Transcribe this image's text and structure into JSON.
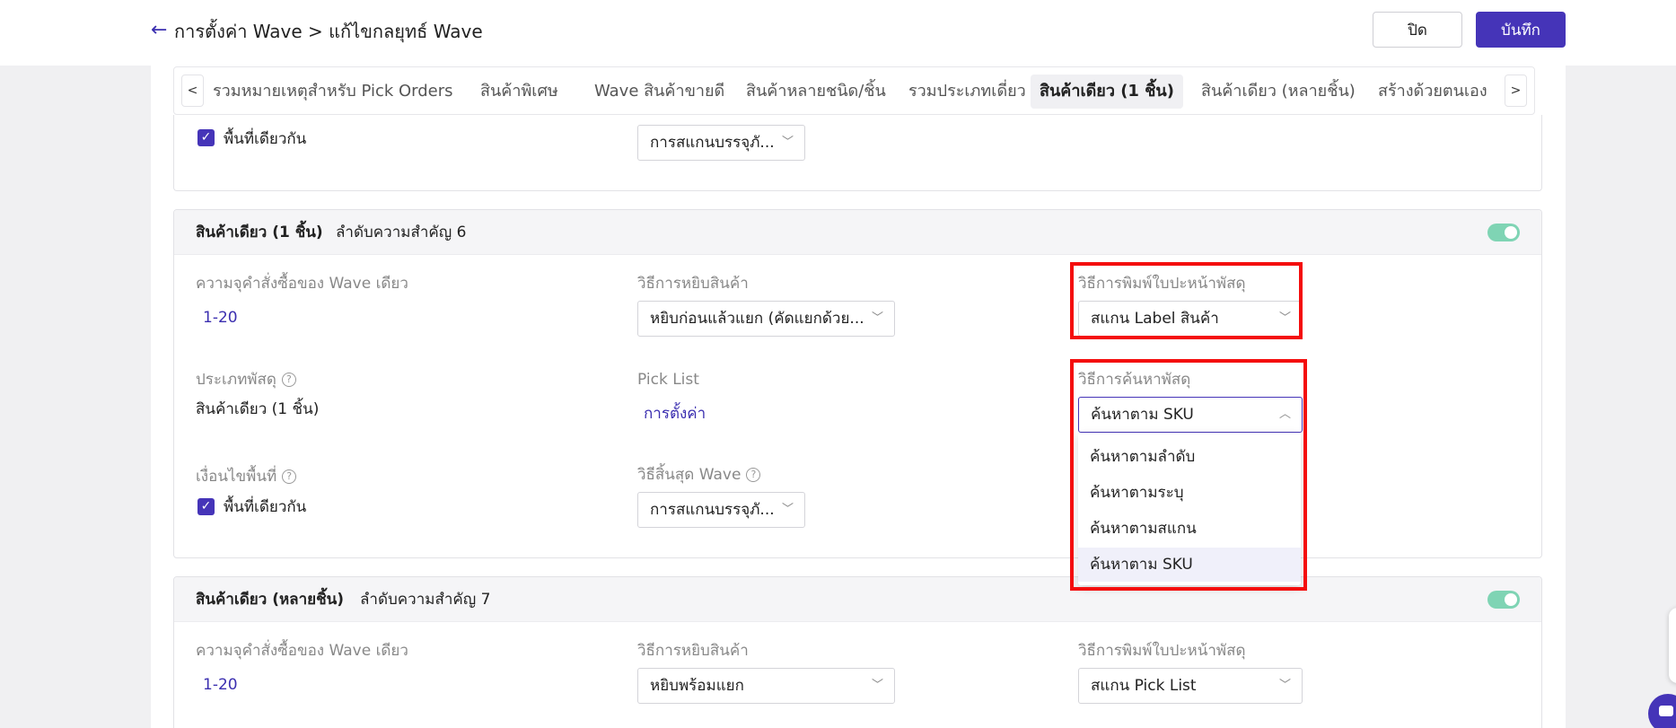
{
  "header": {
    "breadcrumb": "การตั้งค่า Wave > แก้ไขกลยุทธ์ Wave",
    "close_label": "ปิด",
    "save_label": "บันทึก"
  },
  "tabs": [
    "รวมหมายเหตุสำหรับ Pick Orders",
    "สินค้าพิเศษ",
    "Wave สินค้าขายดี",
    "สินค้าหลายชนิด/ชิ้น",
    "รวมประเภทเดี่ยว",
    "สินค้าเดียว (1 ชิ้น)",
    "สินค้าเดียว (หลายชิ้น)",
    "สร้างด้วยตนเอง"
  ],
  "active_tab_index": 5,
  "top_card": {
    "checkbox_label": "พื้นที่เดียวกัน",
    "end_select": "การสแกนบรรจุภั..."
  },
  "card_single": {
    "title": "สินค้าเดียว (1 ชิ้น)",
    "priority": "ลำดับความสำคัญ 6",
    "enabled": true,
    "capacity_label": "ความจุคำสั่งซื้อของ Wave เดียว",
    "capacity_value": "1-20",
    "pick_method_label": "วิธีการหยิบสินค้า",
    "pick_method_value": "หยิบก่อนแล้วแยก (คัดแยกด้วย...",
    "print_method_label": "วิธีการพิมพ์ใบปะหน้าพัสดุ",
    "print_method_value": "สแกน Label สินค้า",
    "parcel_type_label": "ประเภทพัสดุ",
    "parcel_type_value": "สินค้าเดียว (1 ชิ้น)",
    "pick_list_label": "Pick List",
    "pick_list_link": "การตั้งค่า",
    "search_method_label": "วิธีการค้นหาพัสดุ",
    "search_method_value": "ค้นหาตาม SKU",
    "area_condition_label": "เงื่อนไขพื้นที่",
    "area_checkbox_label": "พื้นที่เดียวกัน",
    "wave_end_label": "วิธีสิ้นสุด Wave",
    "wave_end_value": "การสแกนบรรจุภั..."
  },
  "search_dropdown": {
    "options": [
      "ค้นหาตามลำดับ",
      "ค้นหาตามระบุ",
      "ค้นหาตามสแกน",
      "ค้นหาตาม SKU"
    ],
    "selected_index": 3
  },
  "card_multi": {
    "title": "สินค้าเดียว (หลายชิ้น)",
    "priority": "ลำดับความสำคัญ 7",
    "enabled": true,
    "capacity_label": "ความจุคำสั่งซื้อของ Wave เดียว",
    "capacity_value": "1-20",
    "pick_method_label": "วิธีการหยิบสินค้า",
    "pick_method_value": "หยิบพร้อมแยก",
    "print_method_label": "วิธีการพิมพ์ใบปะหน้าพัสดุ",
    "print_method_value": "สแกน Pick List"
  },
  "colors": {
    "brand": "#4534b8",
    "toggle_on": "#7fd4b4",
    "annotation": "#f40d0d"
  }
}
